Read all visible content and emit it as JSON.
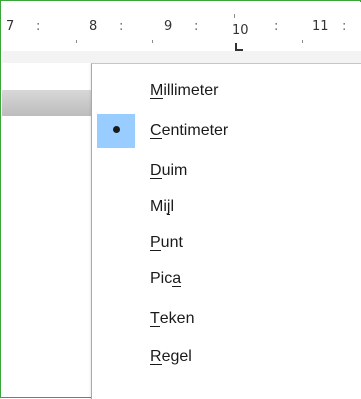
{
  "ruler": {
    "labels": [
      {
        "text": "7",
        "dots": ":"
      },
      {
        "text": "8",
        "dots": ":"
      },
      {
        "text": "9",
        "dots": ":"
      },
      {
        "text": "10",
        "dots": ":"
      },
      {
        "text": "11",
        "dots": ":"
      }
    ]
  },
  "menu": {
    "items": [
      {
        "pre": "",
        "u": "M",
        "post": "illimeter",
        "checked": false
      },
      {
        "pre": "",
        "u": "C",
        "post": "entimeter",
        "checked": true
      },
      {
        "pre": "",
        "u": "D",
        "post": "uim",
        "checked": false
      },
      {
        "pre": "Mi",
        "u": "j",
        "post": "l",
        "checked": false
      },
      {
        "pre": "",
        "u": "P",
        "post": "unt",
        "checked": false
      },
      {
        "pre": "Pic",
        "u": "a",
        "post": "",
        "checked": false
      },
      {
        "pre": "",
        "u": "T",
        "post": "eken",
        "checked": false
      },
      {
        "pre": "",
        "u": "R",
        "post": "egel",
        "checked": false
      }
    ]
  }
}
